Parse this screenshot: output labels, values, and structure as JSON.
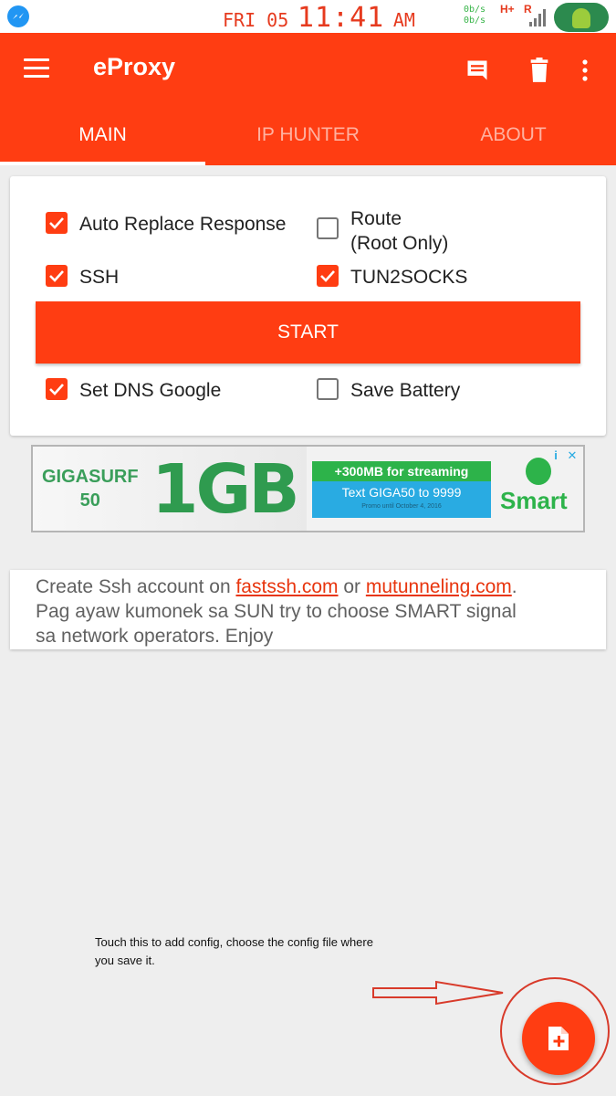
{
  "status_bar": {
    "day": "FRI 05",
    "time": "11:41",
    "ampm": "AM",
    "speed_up": "0b/s",
    "speed_down": "0b/s",
    "network": "H+",
    "roaming": "R"
  },
  "app_bar": {
    "title": "eProxy",
    "icons": [
      "menu-icon",
      "comment-icon",
      "delete-icon",
      "more-vert-icon"
    ]
  },
  "tabs": [
    {
      "label": "MAIN",
      "active": true
    },
    {
      "label": "IP HUNTER",
      "active": false
    },
    {
      "label": "ABOUT",
      "active": false
    }
  ],
  "options": {
    "auto_replace": {
      "label": "Auto Replace Response",
      "checked": true
    },
    "route": {
      "label_line1": "Route",
      "label_line2": "(Root Only)",
      "checked": false
    },
    "ssh": {
      "label": "SSH",
      "checked": true
    },
    "tun2socks": {
      "label": "TUN2SOCKS",
      "checked": true
    },
    "dns": {
      "label": "Set DNS Google",
      "checked": true
    },
    "battery": {
      "label": "Save Battery",
      "checked": false
    }
  },
  "start_button": "START",
  "ad": {
    "brand_line1": "GIGASURF",
    "brand_line2": "50",
    "headline": "1GB",
    "promo_top": "+300MB for streaming",
    "promo_mid": "Text GIGA50 to 9999",
    "promo_fine": "Promo until October 4, 2016",
    "logo_text": "Smart",
    "info_glyph": "i",
    "close_glyph": "✕",
    "colors": {
      "green": "#2db34a",
      "blue": "#29abe2"
    }
  },
  "info": {
    "prefix": "Create Ssh account on ",
    "link1": "fastssh.com",
    "middle": " or ",
    "link2": "mutunneling.com",
    "suffix": ".",
    "line2": "Pag ayaw kumonek sa SUN try to choose SMART signal",
    "line3": "sa network operators. Enjoy"
  },
  "annotation": {
    "note": "Touch this to add config, choose the config file where you save it."
  },
  "fab": {
    "icon": "add-file-icon"
  },
  "colors": {
    "primary": "#ff3d12",
    "status_accent": "#e63a1e",
    "speed_green": "#39b54a"
  }
}
